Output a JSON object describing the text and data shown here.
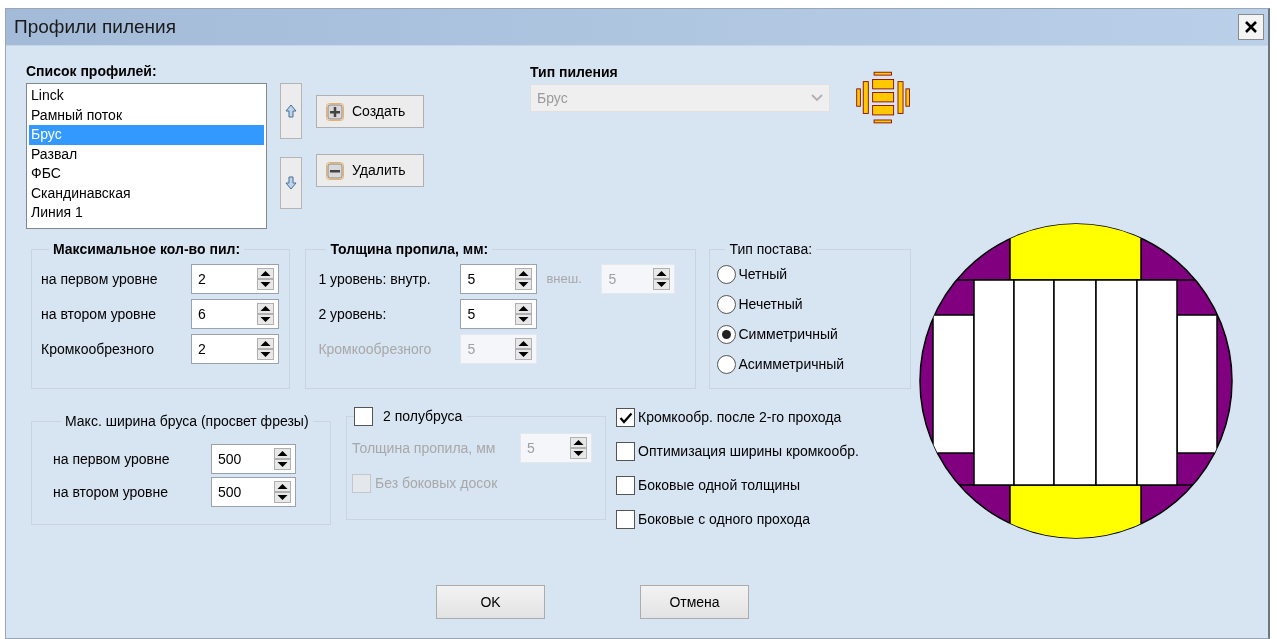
{
  "window": {
    "title": "Профили пиления"
  },
  "profiles": {
    "label": "Список профилей:",
    "items": [
      {
        "label": "Linck",
        "selected": false
      },
      {
        "label": "Рамный поток",
        "selected": false
      },
      {
        "label": "Брус",
        "selected": true
      },
      {
        "label": "Развал",
        "selected": false
      },
      {
        "label": "ФБС",
        "selected": false
      },
      {
        "label": "Скандинавская",
        "selected": false
      },
      {
        "label": "Линия 1",
        "selected": false
      }
    ]
  },
  "actions": [
    {
      "kind": "create",
      "label": "Создать"
    },
    {
      "kind": "delete",
      "label": "Удалить"
    }
  ],
  "sawing_type": {
    "label": "Тип пиления",
    "value": "Брус",
    "disabled": true
  },
  "max_saws": {
    "title": "Максимальное кол-во пил:",
    "fields": [
      {
        "label": "на первом уровне",
        "value": "2",
        "disabled": false
      },
      {
        "label": "на втором уровне",
        "value": "6",
        "disabled": false
      },
      {
        "label": "Кромкообрезного",
        "value": "2",
        "disabled": false
      }
    ]
  },
  "kerf": {
    "title": "Толщина пропила, мм:",
    "fields": [
      {
        "label": "1 уровень: внутр.",
        "value": "5",
        "disabled": false,
        "outer": {
          "label": "внеш.",
          "value": "5",
          "disabled": true
        }
      },
      {
        "label": "2 уровень:",
        "value": "5",
        "disabled": false
      },
      {
        "label": "Кромкообрезного",
        "value": "5",
        "disabled": true
      }
    ]
  },
  "setup_type": {
    "title": "Тип постава:",
    "options": [
      {
        "label": "Четный",
        "selected": false
      },
      {
        "label": "Нечетный",
        "selected": false
      },
      {
        "label": "Симметричный",
        "selected": true
      },
      {
        "label": "Асимметричный",
        "selected": false
      }
    ]
  },
  "max_width": {
    "title": "Макс. ширина бруса (просвет фрезы)",
    "fields": [
      {
        "label": "на первом уровне",
        "value": "500",
        "disabled": false
      },
      {
        "label": "на втором уровне",
        "value": "500",
        "disabled": false
      }
    ]
  },
  "half_beams": {
    "label": "2 полубруса",
    "checked": false,
    "kerf": {
      "label": "Толщина пропила, мм",
      "value": "5",
      "disabled": true
    },
    "no_side_boards": {
      "label": "Без боковых досок",
      "checked": false,
      "disabled": true
    }
  },
  "options": [
    {
      "label": "Кромкообр. после 2-го прохода",
      "checked": true
    },
    {
      "label": "Оптимизация ширины кромкообр.",
      "checked": false
    },
    {
      "label": "Боковые одной толщины",
      "checked": false
    },
    {
      "label": "Боковые с одного прохода",
      "checked": false
    }
  ],
  "buttons": [
    {
      "label": "OK"
    },
    {
      "label": "Отмена"
    }
  ]
}
